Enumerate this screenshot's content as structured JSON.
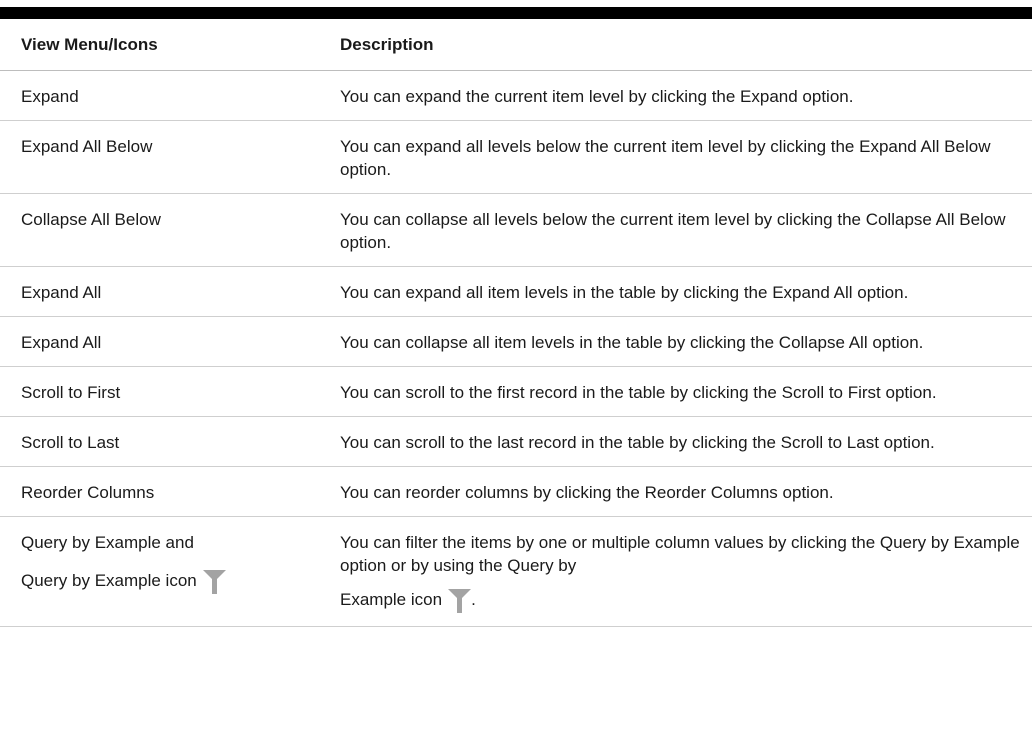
{
  "table": {
    "headers": [
      "View Menu/Icons",
      "Description"
    ],
    "rows": [
      {
        "item": "Expand",
        "description": "You can expand the current item level by clicking the Expand option."
      },
      {
        "item": "Expand All Below",
        "description": "You can expand all levels below the current item level by clicking the Expand All Below option."
      },
      {
        "item": "Collapse All Below",
        "description": "You can collapse all levels below the current item level by clicking the Collapse All Below option."
      },
      {
        "item": "Expand All",
        "description": "You can expand all item levels in the table by clicking the Expand All option."
      },
      {
        "item": "Expand All",
        "description": "You can collapse all item levels in the table by clicking the Collapse All option."
      },
      {
        "item": "Scroll to First",
        "description": "You can scroll to the first record in the table by clicking the Scroll to First option."
      },
      {
        "item": "Scroll to Last",
        "description": "You can scroll to the last record in the table by clicking the Scroll to Last option."
      },
      {
        "item": "Reorder Columns",
        "description": "You can reorder columns by clicking the Reorder Columns option."
      }
    ],
    "last_row": {
      "item_line1": "Query by Example and",
      "item_line2": "Query by Example icon",
      "description_main": "You can filter the items by one or multiple column values by clicking the Query by Example option or by using the Query by",
      "description_tail": "Example icon",
      "description_end": "."
    }
  },
  "icons": {
    "filter": "filter-funnel-icon",
    "filter_color": "#a3a3a3"
  }
}
